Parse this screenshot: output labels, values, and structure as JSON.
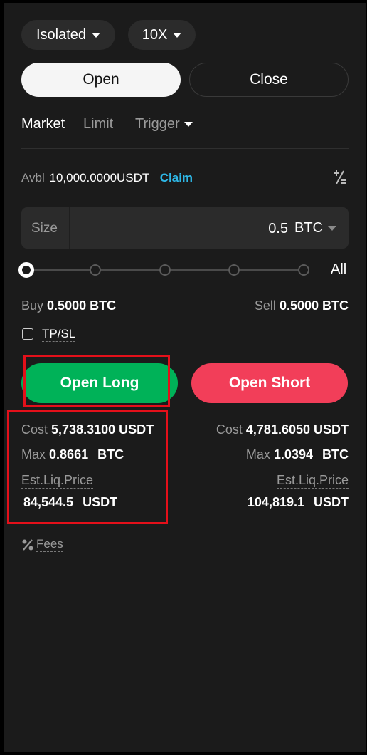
{
  "header": {
    "margin_mode": "Isolated",
    "leverage": "10X"
  },
  "segment": {
    "open_label": "Open",
    "close_label": "Close"
  },
  "order_tabs": {
    "market": "Market",
    "limit": "Limit",
    "trigger": "Trigger"
  },
  "available": {
    "label": "Avbl",
    "value": "10,000.0000USDT",
    "claim": "Claim"
  },
  "size": {
    "label": "Size",
    "value": "0.5",
    "unit": "BTC"
  },
  "slider": {
    "all_label": "All",
    "level": 0
  },
  "buy_sell": {
    "buy_label": "Buy",
    "buy_value": "0.5000 BTC",
    "sell_label": "Sell",
    "sell_value": "0.5000 BTC"
  },
  "tpsl": {
    "label": "TP/SL"
  },
  "actions": {
    "open_long": "Open Long",
    "open_short": "Open Short"
  },
  "long_info": {
    "cost_label": "Cost",
    "cost_value": "5,738.3100 USDT",
    "max_label": "Max",
    "max_value": "0.8661",
    "max_unit": "BTC",
    "liq_label": "Est.Liq.Price",
    "liq_value": "84,544.5",
    "liq_unit": "USDT"
  },
  "short_info": {
    "cost_label": "Cost",
    "cost_value": "4,781.6050 USDT",
    "max_label": "Max",
    "max_value": "1.0394",
    "max_unit": "BTC",
    "liq_label": "Est.Liq.Price",
    "liq_value": "104,819.1",
    "liq_unit": "USDT"
  },
  "fees": {
    "label": "Fees"
  },
  "colors": {
    "long": "#00b258",
    "short": "#f23e59",
    "claim": "#2eb7e6",
    "highlight": "#e4101a"
  }
}
